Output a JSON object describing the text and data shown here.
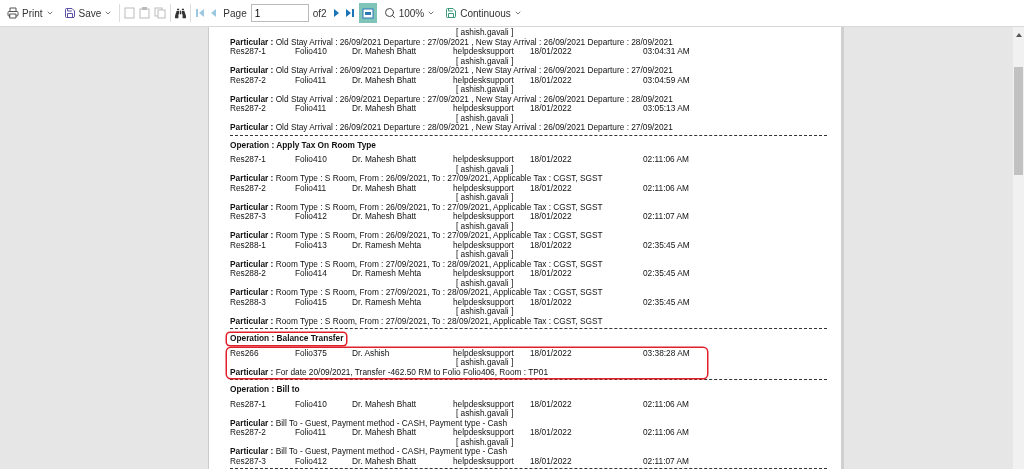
{
  "toolbar": {
    "print": "Print",
    "save": "Save",
    "page_label": "Page",
    "page_value": "1",
    "page_total": "of2",
    "zoom": "100%",
    "view_mode": "Continuous",
    "single_page_selected": true
  },
  "sections": [
    {
      "highlighted": false,
      "records": [
        {
          "login": "[ ashish.gavali ]",
          "particular": "**Particular :** Old Stay Arrival : 26/09/2021 Departure : 27/09/2021 , New Stay Arrival : 26/09/2021 Departure : 28/09/2021"
        },
        {
          "res": "Res287-1",
          "folio": "Folio410",
          "guest": "Dr. Mahesh Bhatt",
          "user": "helpdesksupport",
          "date": "18/01/2022",
          "time": "03:04:31 AM",
          "login": "[ ashish.gavali ]",
          "particular": "**Particular :** Old Stay Arrival : 26/09/2021 Departure : 28/09/2021 , New Stay Arrival : 26/09/2021 Departure : 27/09/2021"
        },
        {
          "res": "Res287-2",
          "folio": "Folio411",
          "guest": "Dr. Mahesh Bhatt",
          "user": "helpdesksupport",
          "date": "18/01/2022",
          "time": "03:04:59 AM",
          "login": "[ ashish.gavali ]",
          "particular": "**Particular :** Old Stay Arrival : 26/09/2021 Departure : 27/09/2021 , New Stay Arrival : 26/09/2021 Departure : 28/09/2021"
        },
        {
          "res": "Res287-2",
          "folio": "Folio411",
          "guest": "Dr. Mahesh Bhatt",
          "user": "helpdesksupport",
          "date": "18/01/2022",
          "time": "03:05:13 AM",
          "login": "[ ashish.gavali ]",
          "particular": "**Particular :** Old Stay Arrival : 26/09/2021 Departure : 28/09/2021 , New Stay Arrival : 26/09/2021 Departure : 27/09/2021"
        }
      ]
    },
    {
      "operation": "Operation : Apply Tax On Room Type",
      "highlighted": false,
      "records": [
        {
          "res": "Res287-1",
          "folio": "Folio410",
          "guest": "Dr. Mahesh Bhatt",
          "user": "helpdesksupport",
          "date": "18/01/2022",
          "time": "02:11:06 AM",
          "login": "[ ashish.gavali ]",
          "particular": "**Particular :** Room Type : S Room, From : 26/09/2021, To : 27/09/2021, Applicable Tax : CGST, SGST"
        },
        {
          "res": "Res287-2",
          "folio": "Folio411",
          "guest": "Dr. Mahesh Bhatt",
          "user": "helpdesksupport",
          "date": "18/01/2022",
          "time": "02:11:06 AM",
          "login": "[ ashish.gavali ]",
          "particular": "**Particular :** Room Type : S Room, From : 26/09/2021, To : 27/09/2021, Applicable Tax : CGST, SGST"
        },
        {
          "res": "Res287-3",
          "folio": "Folio412",
          "guest": "Dr. Mahesh Bhatt",
          "user": "helpdesksupport",
          "date": "18/01/2022",
          "time": "02:11:07 AM",
          "login": "[ ashish.gavali ]",
          "particular": "**Particular :** Room Type : S Room, From : 26/09/2021, To : 27/09/2021, Applicable Tax : CGST, SGST"
        },
        {
          "res": "Res288-1",
          "folio": "Folio413",
          "guest": "Dr. Ramesh Mehta",
          "user": "helpdesksupport",
          "date": "18/01/2022",
          "time": "02:35:45 AM",
          "login": "[ ashish.gavali ]",
          "particular": "**Particular :** Room Type : S Room, From : 27/09/2021, To : 28/09/2021, Applicable Tax : CGST, SGST"
        },
        {
          "res": "Res288-2",
          "folio": "Folio414",
          "guest": "Dr. Ramesh Mehta",
          "user": "helpdesksupport",
          "date": "18/01/2022",
          "time": "02:35:45 AM",
          "login": "[ ashish.gavali ]",
          "particular": "**Particular :** Room Type : S Room, From : 27/09/2021, To : 28/09/2021, Applicable Tax : CGST, SGST"
        },
        {
          "res": "Res288-3",
          "folio": "Folio415",
          "guest": "Dr. Ramesh Mehta",
          "user": "helpdesksupport",
          "date": "18/01/2022",
          "time": "02:35:45 AM",
          "login": "[ ashish.gavali ]",
          "particular": "**Particular :** Room Type : S Room, From : 27/09/2021, To : 28/09/2021, Applicable Tax : CGST, SGST"
        }
      ]
    },
    {
      "operation": "Operation : Balance Transfer",
      "highlighted": true,
      "records": [
        {
          "res": "Res266",
          "folio": "Folio375",
          "guest": "Dr. Ashish",
          "user": "helpdesksupport",
          "date": "18/01/2022",
          "time": "03:38:28 AM",
          "login": "[ ashish.gavali ]",
          "particular": "**Particular :** For date 20/09/2021, Transfer -462.50 RM to Folio Folio406, Room : TP01"
        }
      ]
    },
    {
      "operation": "Operation : Bill to",
      "highlighted": false,
      "records": [
        {
          "res": "Res287-1",
          "folio": "Folio410",
          "guest": "Dr. Mahesh Bhatt",
          "user": "helpdesksupport",
          "date": "18/01/2022",
          "time": "02:11:06 AM",
          "login": "[ ashish.gavali ]",
          "particular": "**Particular :** Bill To - Guest, Payment method - CASH, Payment type - Cash"
        },
        {
          "res": "Res287-2",
          "folio": "Folio411",
          "guest": "Dr. Mahesh Bhatt",
          "user": "helpdesksupport",
          "date": "18/01/2022",
          "time": "02:11:06 AM",
          "login": "[ ashish.gavali ]",
          "particular": "**Particular :** Bill To - Guest, Payment method - CASH, Payment type - Cash"
        },
        {
          "res": "Res287-3",
          "folio": "Folio412",
          "guest": "Dr. Mahesh Bhatt",
          "user": "helpdesksupport",
          "date": "18/01/2022",
          "time": "02:11:07 AM"
        }
      ]
    }
  ]
}
